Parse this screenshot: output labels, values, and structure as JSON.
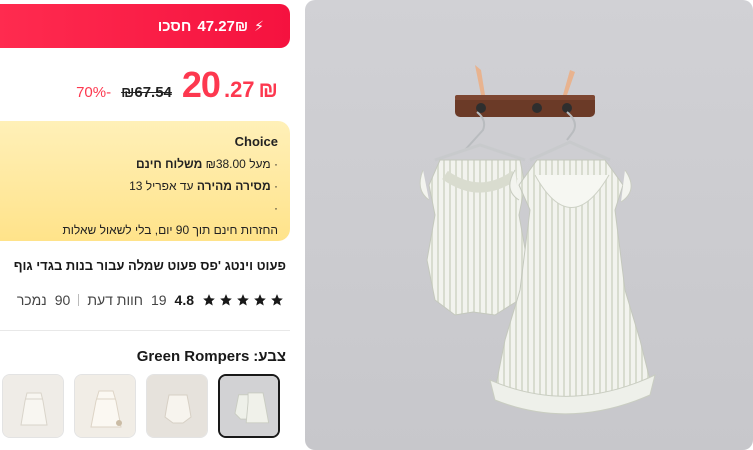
{
  "deal": {
    "amount": "47.27₪",
    "label": "חסכו",
    "icon": "bolt-icon"
  },
  "price": {
    "currency": "₪",
    "integer": "20",
    "decimal": ".27",
    "original": "₪67.54",
    "discount": "70%-"
  },
  "choice": {
    "title": "Choice",
    "line1_prefix": "· מעל ₪38.00 ",
    "line1_bold": "משלוח חינם",
    "line2_prefix": "· ",
    "line2_bold": "מסירה מהירה",
    "line2_suffix": " עד אפריל 13",
    "line3": "·",
    "line4": "החזרות חינם תוך 90 יום, בלי לשאול שאלות",
    "bg_color": "#ffe38a"
  },
  "product": {
    "title": "פעוט וינטג 'פס פעוט שמלה עבור בנות בגדי גוף"
  },
  "rating": {
    "score": "4.8",
    "stars": 5,
    "reviews_count": "19",
    "reviews_label": "חוות דעת",
    "sold_count": "90",
    "sold_label": "נמכר"
  },
  "color": {
    "label": "צבע:",
    "value": "Green Rompers"
  },
  "thumbnails": [
    {
      "name": "green-rompers",
      "selected": true
    },
    {
      "name": "variant-2",
      "selected": false
    },
    {
      "name": "variant-3",
      "selected": false
    },
    {
      "name": "variant-4",
      "selected": false
    }
  ],
  "colors": {
    "accent": "#fd384f",
    "deal_bar": "#f5123f",
    "star": "#191919"
  }
}
